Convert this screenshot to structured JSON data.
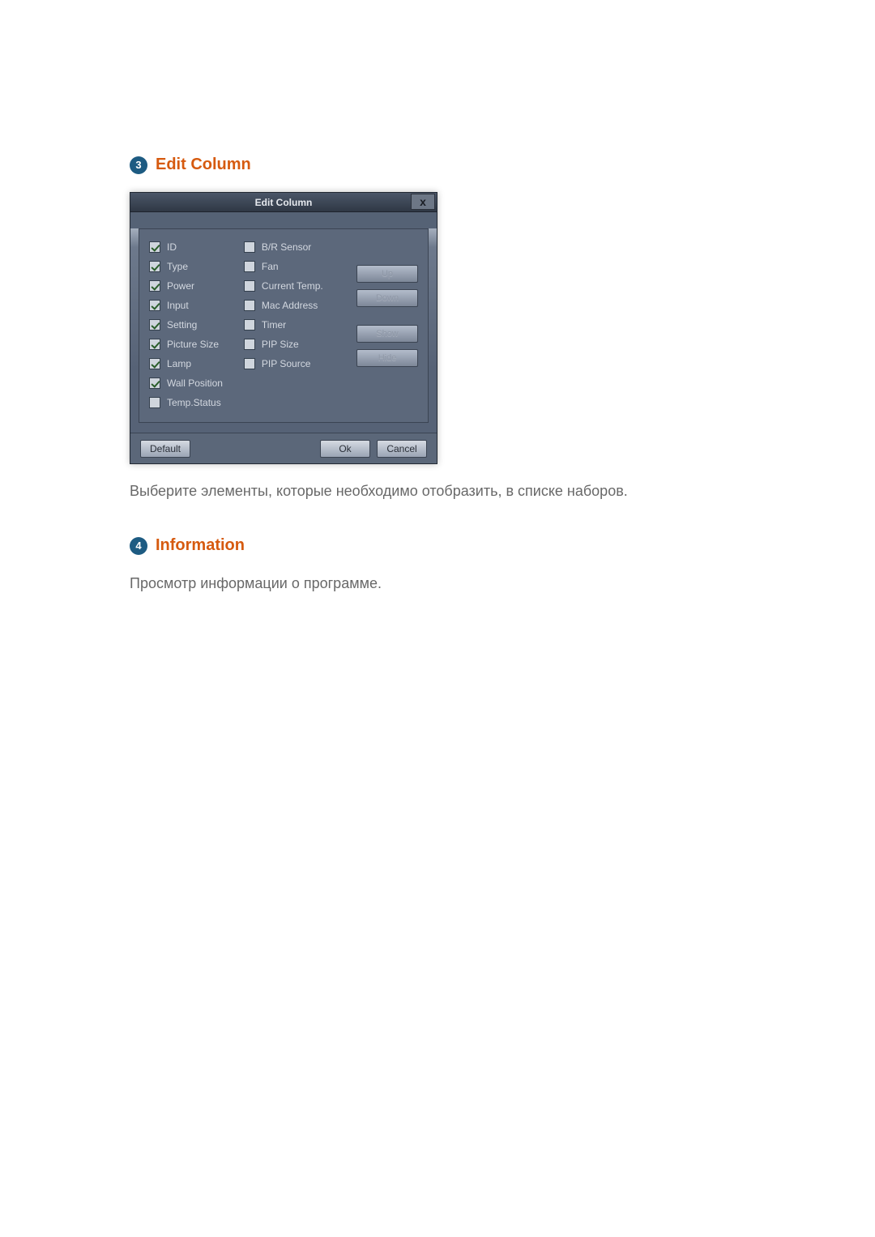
{
  "sections": {
    "edit_column": {
      "badge": "3",
      "title": "Edit Column",
      "caption": "Выберите элементы, которые необходимо отобразить, в списке наборов."
    },
    "information": {
      "badge": "4",
      "title": "Information",
      "caption": "Просмотр информации о программе."
    }
  },
  "dialog": {
    "title": "Edit Column",
    "close_text": "x",
    "left_items": [
      {
        "label": "ID",
        "checked": true
      },
      {
        "label": "Type",
        "checked": true
      },
      {
        "label": "Power",
        "checked": true
      },
      {
        "label": "Input",
        "checked": true
      },
      {
        "label": "Setting",
        "checked": true
      },
      {
        "label": "Picture Size",
        "checked": true
      },
      {
        "label": "Lamp",
        "checked": true
      },
      {
        "label": "Wall Position",
        "checked": true
      },
      {
        "label": "Temp.Status",
        "checked": false
      }
    ],
    "right_items": [
      {
        "label": "B/R Sensor",
        "checked": false
      },
      {
        "label": "Fan",
        "checked": false
      },
      {
        "label": "Current Temp.",
        "checked": false
      },
      {
        "label": "Mac Address",
        "checked": false
      },
      {
        "label": "Timer",
        "checked": false
      },
      {
        "label": "PIP Size",
        "checked": false
      },
      {
        "label": "PIP Source",
        "checked": false
      }
    ],
    "side_buttons": {
      "up": "Up",
      "down": "Down",
      "show": "Show",
      "hide": "Hide"
    },
    "footer": {
      "default": "Default",
      "ok": "Ok",
      "cancel": "Cancel"
    }
  }
}
